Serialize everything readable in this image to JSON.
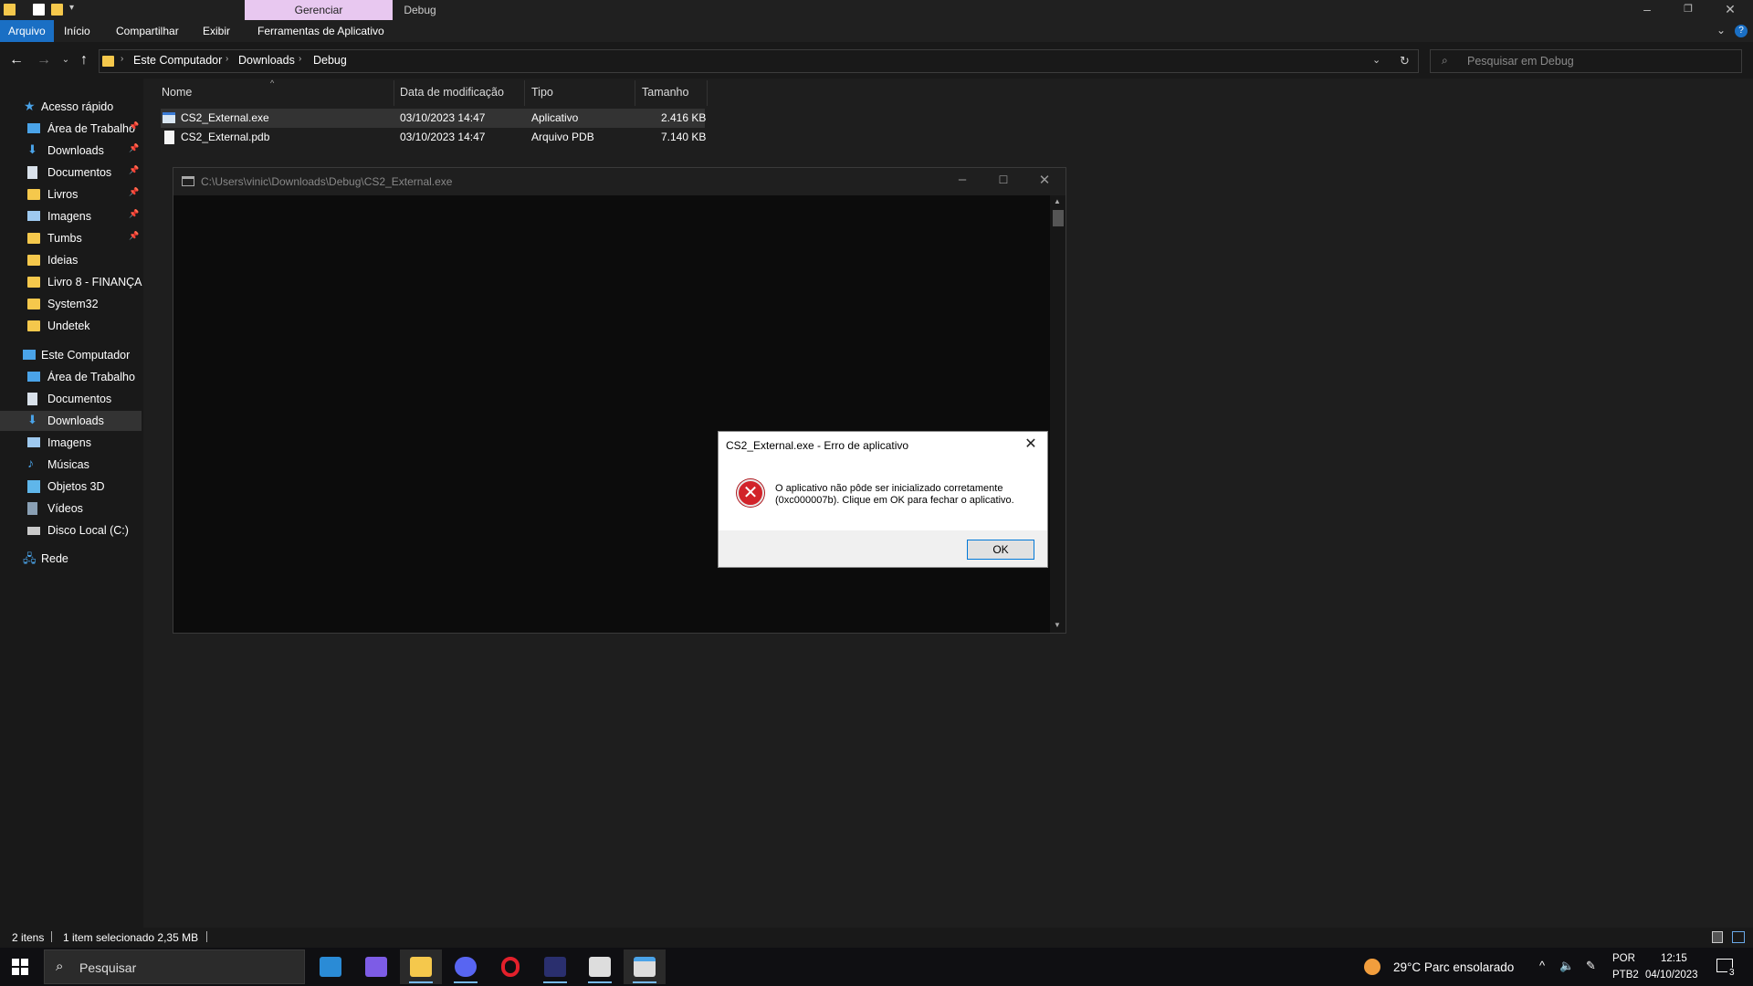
{
  "titlebar": {
    "context_tab": "Gerenciar",
    "window_title": "Debug",
    "context_color": "#e8c8f0"
  },
  "ribbon": {
    "tabs": [
      "Arquivo",
      "Início",
      "Compartilhar",
      "Exibir",
      "Ferramentas de Aplicativo"
    ]
  },
  "address": {
    "crumbs": [
      "Este Computador",
      "Downloads",
      "Debug"
    ],
    "search_placeholder": "Pesquisar em Debug"
  },
  "sidebar": {
    "quick_access": "Acesso rápido",
    "quick_items": [
      {
        "label": "Área de Trabalho",
        "icon": "desktop-icon",
        "pinned": true
      },
      {
        "label": "Downloads",
        "icon": "downloads-icon",
        "pinned": true
      },
      {
        "label": "Documentos",
        "icon": "documents-icon",
        "pinned": true
      },
      {
        "label": "Livros",
        "icon": "folder-icon",
        "pinned": true
      },
      {
        "label": "Imagens",
        "icon": "pictures-icon",
        "pinned": true
      },
      {
        "label": "Tumbs",
        "icon": "folder-icon",
        "pinned": true
      },
      {
        "label": "Ideias",
        "icon": "folder-icon",
        "pinned": false
      },
      {
        "label": "Livro 8 - FINANÇAS",
        "icon": "folder-icon",
        "pinned": false
      },
      {
        "label": "System32",
        "icon": "folder-icon",
        "pinned": false
      },
      {
        "label": "Undetek",
        "icon": "folder-icon",
        "pinned": false
      }
    ],
    "this_pc": "Este Computador",
    "pc_items": [
      {
        "label": "Área de Trabalho",
        "icon": "desktop-icon"
      },
      {
        "label": "Documentos",
        "icon": "documents-icon"
      },
      {
        "label": "Downloads",
        "icon": "downloads-icon"
      },
      {
        "label": "Imagens",
        "icon": "pictures-icon"
      },
      {
        "label": "Músicas",
        "icon": "music-icon"
      },
      {
        "label": "Objetos 3D",
        "icon": "3d-objects-icon"
      },
      {
        "label": "Vídeos",
        "icon": "videos-icon"
      },
      {
        "label": "Disco Local (C:)",
        "icon": "drive-icon"
      }
    ],
    "network": "Rede"
  },
  "filelist": {
    "columns": [
      "Nome",
      "Data de modificação",
      "Tipo",
      "Tamanho"
    ],
    "rows": [
      {
        "name": "CS2_External.exe",
        "date": "03/10/2023 14:47",
        "type": "Aplicativo",
        "size": "2.416 KB"
      },
      {
        "name": "CS2_External.pdb",
        "date": "03/10/2023 14:47",
        "type": "Arquivo PDB",
        "size": "7.140 KB"
      }
    ]
  },
  "console": {
    "title": "C:\\Users\\vinic\\Downloads\\Debug\\CS2_External.exe"
  },
  "dialog": {
    "title": "CS2_External.exe - Erro de aplicativo",
    "message": "O aplicativo não pôde ser inicializado corretamente (0xc000007b). Clique em OK para fechar o aplicativo.",
    "ok_label": "OK"
  },
  "statusbar": {
    "count": "2 itens",
    "selection": "1 item selecionado  2,35 MB"
  },
  "taskbar": {
    "search_placeholder": "Pesquisar",
    "weather": "29°C  Parc ensolarado",
    "lang_top": "POR",
    "lang_bottom": "PTB2",
    "time": "12:15",
    "date": "04/10/2023",
    "notifications": "3"
  }
}
